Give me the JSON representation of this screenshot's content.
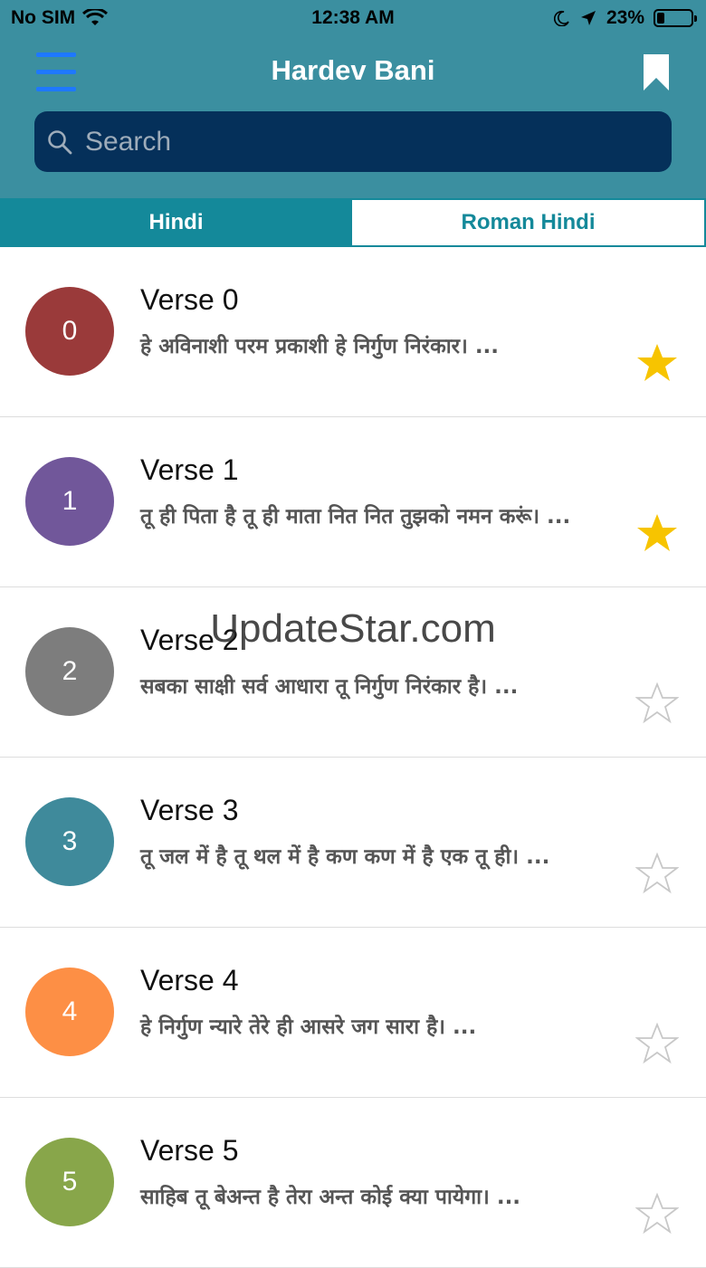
{
  "status_bar": {
    "carrier": "No SIM",
    "time": "12:38 AM",
    "battery": "23%",
    "battery_level": 0.23
  },
  "header": {
    "title": "Hardev Bani",
    "menu_icon": "hamburger-menu-icon",
    "bookmark_icon": "bookmark-icon"
  },
  "search": {
    "placeholder": "Search",
    "value": ""
  },
  "tabs": [
    {
      "label": "Hindi",
      "active": true
    },
    {
      "label": "Roman Hindi",
      "active": false
    }
  ],
  "verses": [
    {
      "number": "0",
      "title": "Verse 0",
      "text": "हे अविनाशी परम प्रकाशी हे निर्गुण निरंकार। ...",
      "color": "#9a3a3a",
      "favorite": true
    },
    {
      "number": "1",
      "title": "Verse 1",
      "text": "तू ही पिता है तू ही माता नित नित तुझको नमन करूं। ...",
      "color": "#71579a",
      "favorite": true
    },
    {
      "number": "2",
      "title": "Verse 2",
      "text": "सबका साक्षी सर्व आधारा तू निर्गुण निरंकार है। ...",
      "color": "#7d7d7d",
      "favorite": false
    },
    {
      "number": "3",
      "title": "Verse 3",
      "text": "तू जल में है तू थल में है कण कण में है एक तू ही। ...",
      "color": "#3f8a9b",
      "favorite": false
    },
    {
      "number": "4",
      "title": "Verse 4",
      "text": "हे निर्गुण न्यारे तेरे ही आसरे जग सारा है। ...",
      "color": "#fd8f45",
      "favorite": false
    },
    {
      "number": "5",
      "title": "Verse 5",
      "text": "साहिब तू बेअन्त है तेरा अन्त कोई क्या पायेगा। ...",
      "color": "#88a64a",
      "favorite": false
    }
  ],
  "watermark": "UpdateStar.com"
}
